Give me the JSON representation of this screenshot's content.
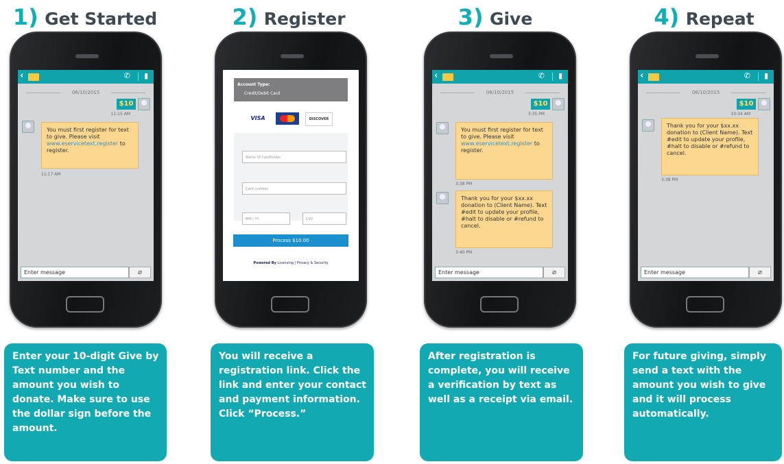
{
  "steps": [
    {
      "number": "1)",
      "title": "Get Started",
      "date": "06/10/2015",
      "amount": "$10",
      "time_sent": "11:15 AM",
      "reply": {
        "before": "You must first register for text to give. Please visit",
        "link": "www.eservicetext.register",
        "after": "to register."
      },
      "reply_time": "11:17 AM",
      "input_placeholder": "Enter message",
      "description": "Enter your 10-digit Give by Text number and the amount you wish to donate. Make sure to use the dollar sign before the amount."
    },
    {
      "number": "2)",
      "title": "Register",
      "account_type_label": "Account Type:",
      "account_type_value": "Credit/Debit Card",
      "card_brands": [
        "VISA",
        "MasterCard",
        "DISCOVER"
      ],
      "fields": {
        "name": "Name Of Cardholder",
        "card": "Card number",
        "expiry": "MM / YY",
        "cvv": "CVV"
      },
      "process_button": "Process $10.00",
      "powered_by": "Powered By",
      "powered_links": "Licensing | Privacy & Security",
      "description": "You will receive a registration link. Click the link and enter your contact and payment information. Click “Process.”"
    },
    {
      "number": "3)",
      "title": "Give",
      "date": "06/10/2015",
      "amount": "$10",
      "time_sent": "3:35 PM",
      "reply": {
        "before": "You must first register for text to give. Please visit",
        "link": "www.eservicetext.register",
        "after": "to register."
      },
      "reply_time": "3:38 PM",
      "reply2": "Thank you for your $xx.xx donation to (Client Name). Text #edit to update your profile, #halt to disable or #refund to cancel.",
      "reply2_time": "3:40 PM",
      "input_placeholder": "Enter message",
      "description": "After registration is complete, you will receive a verification by text as well as a receipt via email."
    },
    {
      "number": "4)",
      "title": "Repeat",
      "date": "06/10/2015",
      "amount": "$10",
      "time_sent": "10:34 AM",
      "reply2": "Thank you for your $xx.xx donation to (Client Name). Text #edit to update your profile, #halt to disable or #refund to cancel.",
      "reply2_time": "3:38 PM",
      "input_placeholder": "Enter message",
      "description": "For future giving, simply send a text with the amount you wish to give and it will process automatically."
    }
  ]
}
